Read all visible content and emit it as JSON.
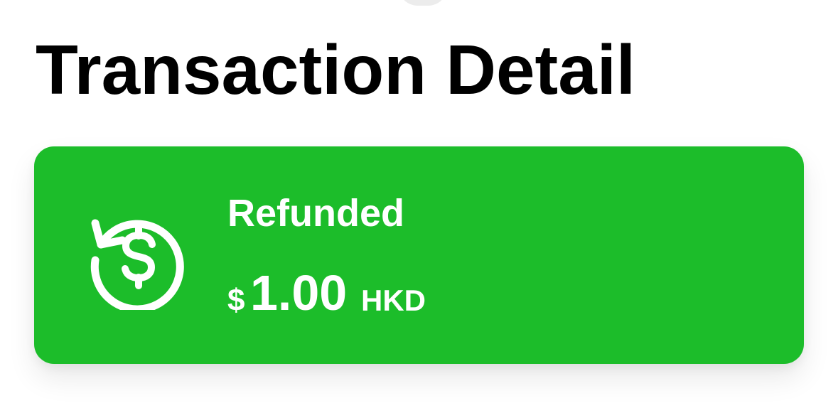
{
  "header": {
    "title": "Transaction Detail"
  },
  "transaction": {
    "status": "Refunded",
    "currency_symbol": "$",
    "amount": "1.00",
    "currency_code": "HKD",
    "status_icon": "refund-dollar-icon"
  },
  "colors": {
    "card_background": "#1cbd2a",
    "card_foreground": "#ffffff",
    "title_text": "#000000"
  }
}
